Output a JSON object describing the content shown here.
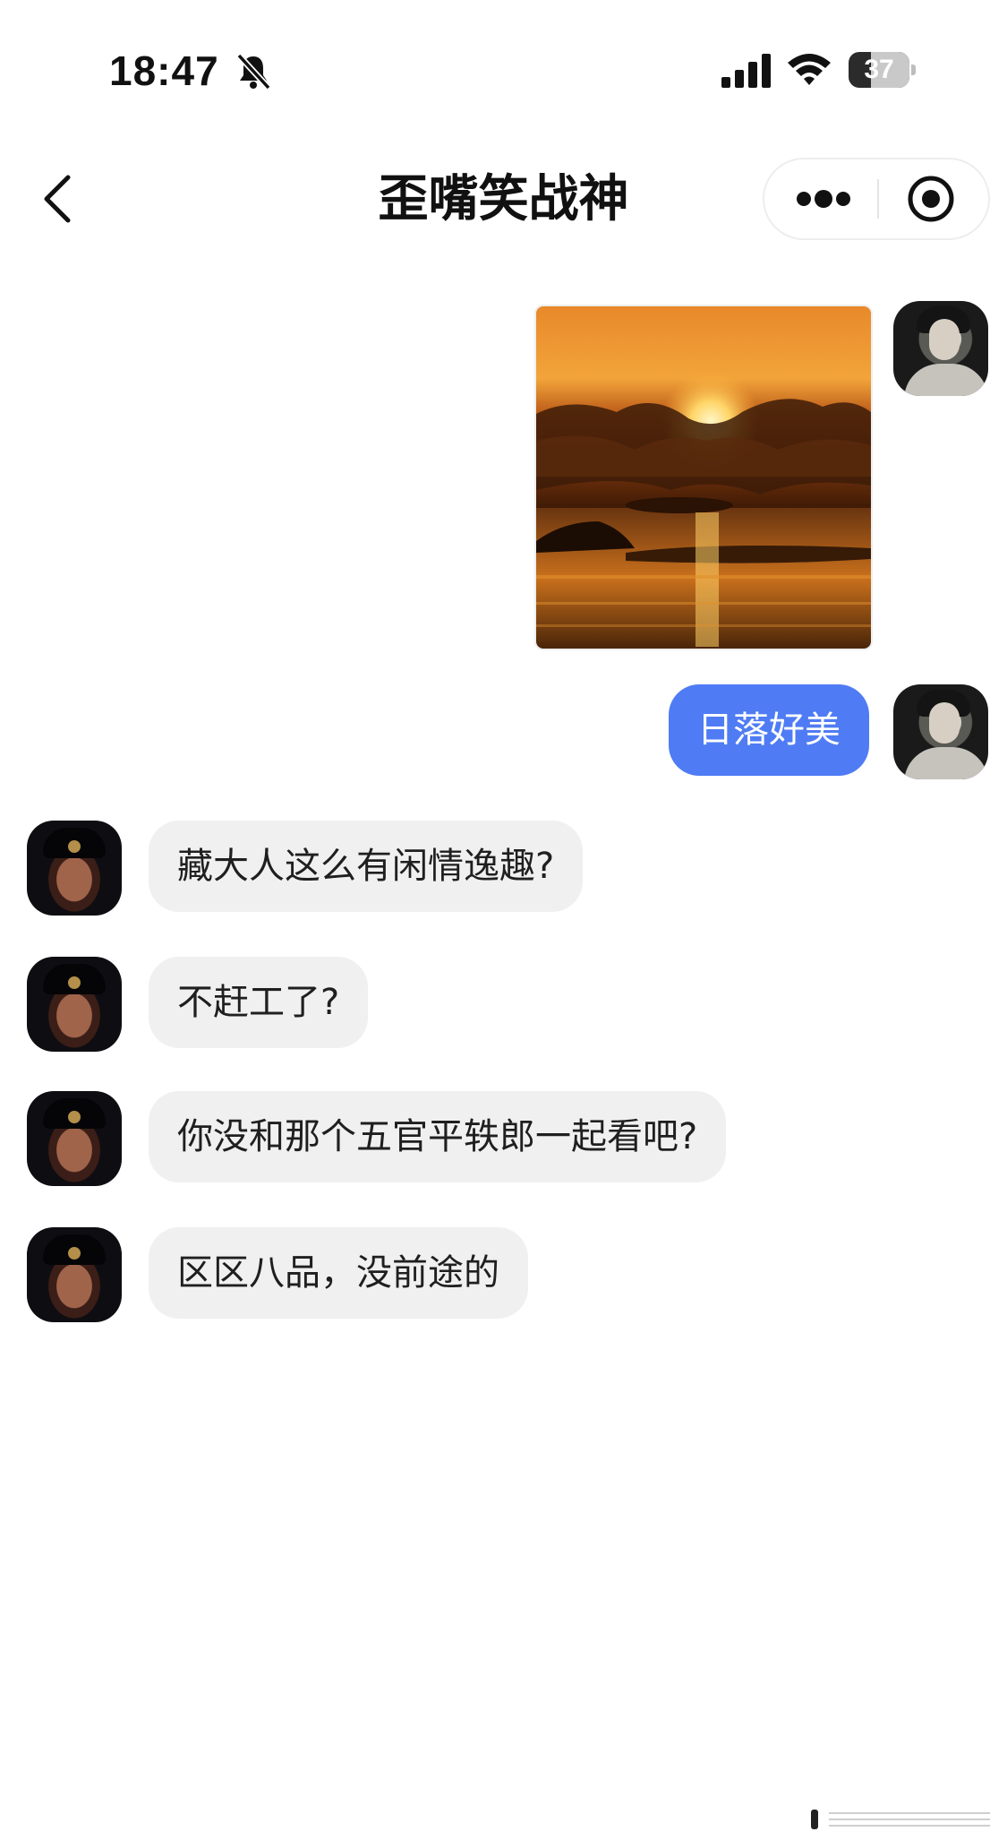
{
  "status_bar": {
    "time": "18:47",
    "battery_level": "37",
    "battery_fraction": 0.37
  },
  "nav": {
    "title": "歪嘴笑战神"
  },
  "messages": [
    {
      "side": "self",
      "type": "image",
      "image_alt": "sunset-over-sea-photo"
    },
    {
      "side": "self",
      "type": "text",
      "text": "日落好美"
    },
    {
      "side": "other",
      "type": "text",
      "text": "藏大人这么有闲情逸趣?"
    },
    {
      "side": "other",
      "type": "text",
      "text": "不赶工了?"
    },
    {
      "side": "other",
      "type": "text",
      "text": "你没和那个五官平轶郎一起看吧?"
    },
    {
      "side": "other",
      "type": "text",
      "text": "区区八品，没前途的"
    }
  ],
  "colors": {
    "self_bubble": "#4f7cf4",
    "other_bubble": "#f0f0f0",
    "background": "#ffffff"
  },
  "icons": [
    "bell-muted-icon",
    "signal-icon",
    "wifi-icon",
    "battery-icon",
    "back-chevron-icon",
    "more-dots-icon",
    "close-target-icon"
  ]
}
